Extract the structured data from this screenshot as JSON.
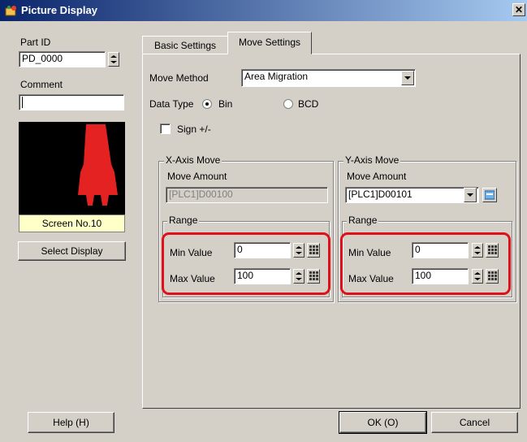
{
  "window": {
    "title": "Picture Display",
    "close_symbol": "✕"
  },
  "left": {
    "part_id_label": "Part ID",
    "part_id_value": "PD_0000",
    "comment_label": "Comment",
    "comment_value": "",
    "preview_caption": "Screen No.10",
    "select_display_label": "Select Display"
  },
  "tabs": [
    {
      "label": "Basic Settings"
    },
    {
      "label": "Move Settings"
    }
  ],
  "move": {
    "method_label": "Move Method",
    "method_value": "Area Migration",
    "data_type_label": "Data Type",
    "data_type_options": [
      "Bin",
      "BCD"
    ],
    "data_type_selected": "Bin",
    "sign_label": "Sign +/-"
  },
  "x_axis": {
    "group_title": "X-Axis Move",
    "amount_label": "Move Amount",
    "amount_value": "[PLC1]D00100",
    "range_title": "Range",
    "min_label": "Min Value",
    "min_value": "0",
    "max_label": "Max Value",
    "max_value": "100"
  },
  "y_axis": {
    "group_title": "Y-Axis Move",
    "amount_label": "Move Amount",
    "amount_value": "[PLC1]D00101",
    "range_title": "Range",
    "min_label": "Min Value",
    "min_value": "0",
    "max_label": "Max Value",
    "max_value": "100"
  },
  "footer": {
    "help_label": "Help (H)",
    "ok_label": "OK (O)",
    "cancel_label": "Cancel"
  },
  "colors": {
    "highlight": "#e0101a",
    "preview_shape": "#e52222",
    "title_bar": "#0a246a"
  }
}
